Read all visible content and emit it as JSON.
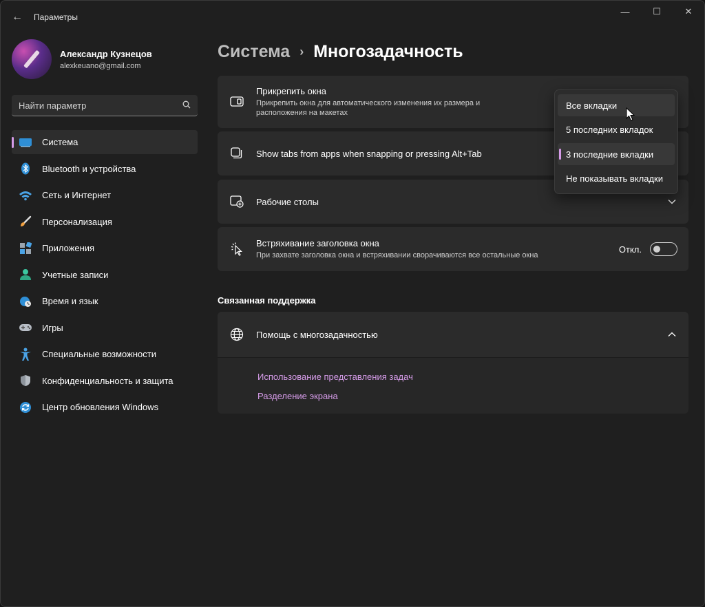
{
  "window": {
    "title": "Параметры",
    "back_glyph": "←",
    "caption": {
      "minimize": "—",
      "maximize": "☐",
      "close": "✕"
    }
  },
  "profile": {
    "name": "Александр Кузнецов",
    "email": "alexkeuano@gmail.com"
  },
  "search": {
    "placeholder": "Найти параметр"
  },
  "sidebar": {
    "items": [
      {
        "label": "Система",
        "icon": "system-icon",
        "active": true
      },
      {
        "label": "Bluetooth и устройства",
        "icon": "bluetooth-icon"
      },
      {
        "label": "Сеть и Интернет",
        "icon": "wifi-icon"
      },
      {
        "label": "Персонализация",
        "icon": "brush-icon"
      },
      {
        "label": "Приложения",
        "icon": "apps-icon"
      },
      {
        "label": "Учетные записи",
        "icon": "person-icon"
      },
      {
        "label": "Время и язык",
        "icon": "globe-clock-icon"
      },
      {
        "label": "Игры",
        "icon": "gamepad-icon"
      },
      {
        "label": "Специальные возможности",
        "icon": "accessibility-icon"
      },
      {
        "label": "Конфиденциальность и защита",
        "icon": "shield-icon"
      },
      {
        "label": "Центр обновления Windows",
        "icon": "update-icon"
      }
    ]
  },
  "breadcrumb": {
    "parent": "Система",
    "separator": "›",
    "current": "Многозадачность"
  },
  "cards": {
    "snap": {
      "title": "Прикрепить окна",
      "desc": "Прикрепить окна для автоматического изменения их размера и расположения на макетах"
    },
    "tabs": {
      "title": "Show tabs from apps when snapping or pressing Alt+Tab"
    },
    "desktops": {
      "title": "Рабочие столы"
    },
    "shake": {
      "title": "Встряхивание заголовка окна",
      "desc": "При захвате заголовка окна и встряхивании сворачиваются все остальные окна",
      "toggle_label": "Откл.",
      "toggle_on": false
    }
  },
  "support": {
    "section_title": "Связанная поддержка",
    "help_title": "Помощь с многозадачностью",
    "links": [
      "Использование представления задач",
      "Разделение экрана"
    ]
  },
  "dropdown": {
    "options": [
      "Все вкладки",
      "5 последних вкладок",
      "3 последние вкладки",
      "Не показывать вкладки"
    ],
    "selected": "3 последние вкладки",
    "hovered": "Все вкладки"
  },
  "colors": {
    "accent": "#d59be8",
    "link": "#d69ce9",
    "card_bg": "#2b2b2b",
    "window_bg": "#1f1f1f"
  }
}
